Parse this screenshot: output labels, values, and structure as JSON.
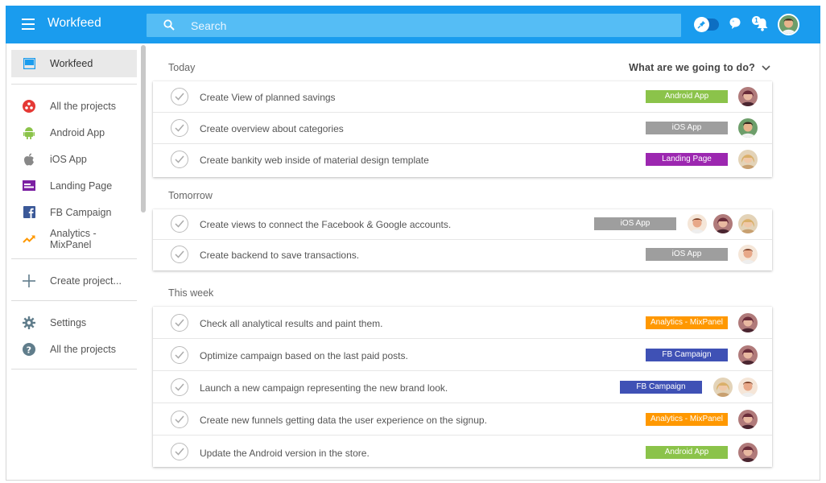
{
  "app": {
    "title": "Workfeed"
  },
  "search": {
    "placeholder": "Search"
  },
  "notifications": {
    "count": "1"
  },
  "colors": {
    "brand": "#1a9cee",
    "android": "#8bc34a",
    "ios": "#9e9e9e",
    "landing": "#9c27b0",
    "analytics": "#ff9800",
    "fb": "#3f51b5"
  },
  "sidebar": {
    "items": [
      {
        "label": "Workfeed",
        "icon": "inbox-icon"
      },
      {
        "label": "All the projects",
        "icon": "projects-icon"
      },
      {
        "label": "Android App",
        "icon": "android-icon"
      },
      {
        "label": "iOS App",
        "icon": "apple-icon"
      },
      {
        "label": "Landing Page",
        "icon": "landing-page-icon"
      },
      {
        "label": "FB Campaign",
        "icon": "facebook-icon"
      },
      {
        "label": "Analytics - MixPanel",
        "icon": "analytics-icon"
      },
      {
        "label": "Create project...",
        "icon": "plus-icon"
      },
      {
        "label": "Settings",
        "icon": "gear-icon"
      },
      {
        "label": "All the projects",
        "icon": "help-icon"
      }
    ]
  },
  "main": {
    "filter_label": "What are we going to do?",
    "sections": [
      {
        "title": "Today",
        "tasks": [
          {
            "text": "Create View of planned savings",
            "tag": "Android App"
          },
          {
            "text": "Create overview about categories",
            "tag": "iOS App"
          },
          {
            "text": "Create bankity web inside of material design template",
            "tag": "Landing Page"
          }
        ]
      },
      {
        "title": "Tomorrow",
        "tasks": [
          {
            "text": "Create views to connect the Facebook & Google accounts.",
            "tag": "iOS App"
          },
          {
            "text": "Create backend to save transactions.",
            "tag": "iOS App"
          }
        ]
      },
      {
        "title": "This week",
        "tasks": [
          {
            "text": "Check all analytical results and paint them.",
            "tag": "Analytics - MixPanel"
          },
          {
            "text": "Optimize campaign based on the last paid posts.",
            "tag": "FB Campaign"
          },
          {
            "text": "Launch a new campaign representing the new brand look.",
            "tag": "FB Campaign"
          },
          {
            "text": "Create new funnels getting data the user experience on the signup.",
            "tag": "Analytics - MixPanel"
          },
          {
            "text": "Update the Android version in the store.",
            "tag": "Android App"
          }
        ]
      }
    ]
  }
}
